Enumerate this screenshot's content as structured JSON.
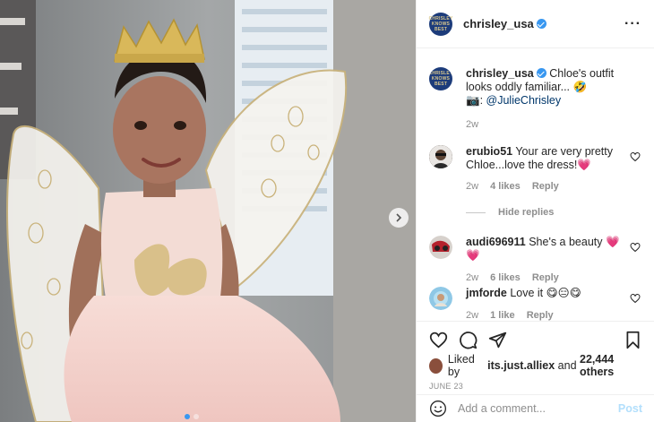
{
  "post": {
    "author": "chrisley_usa",
    "logo_text": "CHRISLEY KNOWS BEST",
    "more_icon": "more-horizontal-icon",
    "accent": "#3897f0"
  },
  "caption": {
    "username": "chrisley_usa",
    "text": "Chloe's outfit looks oddly familiar...",
    "emoji": "🤣",
    "camera": "📷:",
    "mention": "@JulieChrisley",
    "time": "2w"
  },
  "comments": [
    {
      "username": "erubio51",
      "text": "Your are very pretty Chloe...love the dress!",
      "emoji": "💗",
      "time": "2w",
      "likes": "4 likes",
      "reply": "Reply"
    },
    {
      "username": "audi696911",
      "text": "She's a beauty",
      "emoji": "💗💗",
      "time": "2w",
      "likes": "6 likes",
      "reply": "Reply"
    },
    {
      "username": "jmforde",
      "text": "Love it",
      "emoji": "😋😑😋",
      "time": "2w",
      "likes": "1 like",
      "reply": "Reply"
    }
  ],
  "hide_replies": "Hide replies",
  "likes": {
    "prefix": "Liked by",
    "user": "its.just.alliex",
    "middle": "and",
    "count": "22,444 others"
  },
  "date": "JUNE 23",
  "add_comment": {
    "placeholder": "Add a comment...",
    "post_label": "Post"
  }
}
